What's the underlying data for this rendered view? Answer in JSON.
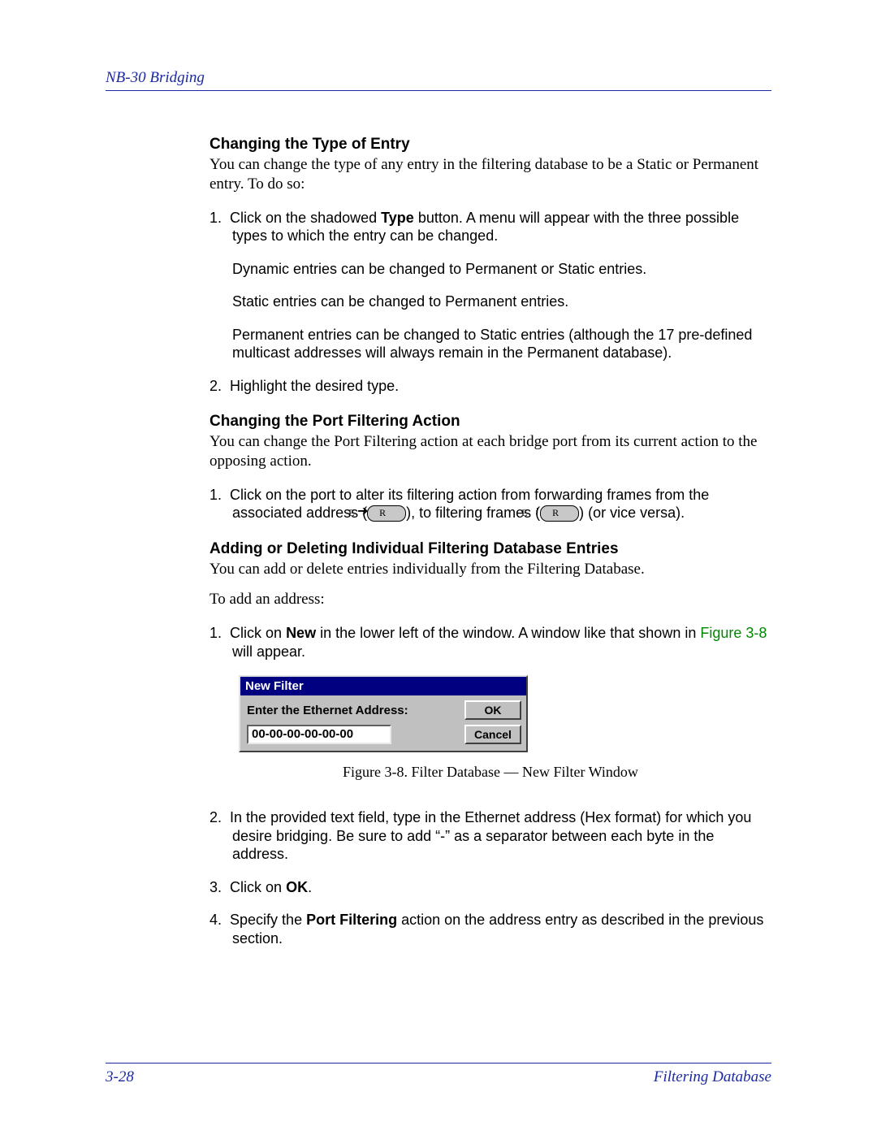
{
  "header": {
    "title": "NB-30 Bridging"
  },
  "sections": {
    "s1": {
      "heading": "Changing the Type of Entry",
      "intro": "You can change the type of any entry in the filtering database to be a Static or Permanent entry. To do so:",
      "li1_a": "Click on the shadowed ",
      "li1_bold": "Type",
      "li1_b": " button. A menu will appear with the three possible types to which the entry can be changed.",
      "li1_sub1": "Dynamic entries can be changed to Permanent or Static entries.",
      "li1_sub2": "Static entries can be changed to Permanent entries.",
      "li1_sub3": "Permanent entries can be changed to Static entries (although the 17 pre-defined multicast addresses will always remain in the Permanent database).",
      "li2": "Highlight the desired type."
    },
    "s2": {
      "heading": "Changing the Port Filtering Action",
      "intro": "You can change the Port Filtering action at each bridge port from its current action to the opposing action.",
      "li1_a": "Click on the port to alter its filtering action from forwarding frames from the associated address (",
      "li1_b": "), to filtering frames (",
      "li1_c": ") (or vice versa)."
    },
    "s3": {
      "heading": "Adding or Deleting Individual Filtering Database Entries",
      "intro": "You can add or delete entries individually from the Filtering Database.",
      "toadd": "To add an address:",
      "li1_a": "Click on ",
      "li1_bold": "New",
      "li1_b": " in the lower left of the window. A window like that shown in ",
      "li1_link": "Figure 3-8",
      "li1_c": " will appear.",
      "li2": "In the provided text field, type in the Ethernet address (Hex format) for which you desire bridging. Be sure to add “-” as a separator between each byte in the address.",
      "li3_a": "Click on ",
      "li3_bold": "OK",
      "li3_b": ".",
      "li4_a": "Specify the ",
      "li4_bold": "Port Filtering",
      "li4_b": " action on the address entry as described in the previous section."
    }
  },
  "dialog": {
    "title": "New Filter",
    "label": "Enter the Ethernet Address:",
    "value": "00-00-00-00-00-00",
    "ok": "OK",
    "cancel": "Cancel"
  },
  "caption": "Figure 3-8.  Filter Database — New Filter Window",
  "footer": {
    "page": "3-28",
    "section": "Filtering Database"
  },
  "li_nums": {
    "n1": "1.",
    "n2": "2.",
    "n3": "3.",
    "n4": "4."
  }
}
